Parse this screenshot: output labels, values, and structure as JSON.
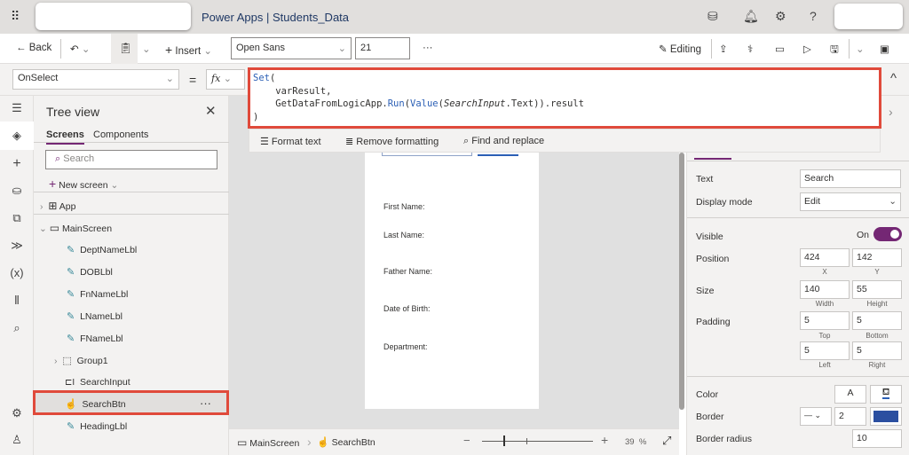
{
  "header": {
    "app": "Power Apps",
    "separator": "|",
    "doc": "Students_Data",
    "icons": [
      "waffle-icon",
      "environment-icon",
      "bell-icon",
      "gear-icon",
      "help-icon"
    ]
  },
  "toolbar": {
    "back": "Back",
    "insert": "Insert",
    "font": "Open Sans",
    "font_size": "21",
    "more": "···",
    "editing": "Editing"
  },
  "formula": {
    "property": "OnSelect",
    "equals": "=",
    "fx": "fx",
    "line1_fn": "Set",
    "line1_rest": "(",
    "line2": "    varResult,",
    "line3_a": "    GetDataFromLogicApp.",
    "line3_run": "Run",
    "line3_b": "(",
    "line3_val": "Value",
    "line3_c": "(",
    "line3_arg": "SearchInput",
    "line3_d": ".Text)).result",
    "line4": ")"
  },
  "format_bar": {
    "format_text": "Format text",
    "remove_formatting": "Remove formatting",
    "find_replace": "Find and replace"
  },
  "tree": {
    "title": "Tree view",
    "tabs": [
      "Screens",
      "Components"
    ],
    "search_placeholder": "Search",
    "new_screen": "New screen",
    "app": "App",
    "screen": "MainScreen",
    "items": [
      "DeptNameLbl",
      "DOBLbl",
      "FnNameLbl",
      "LNameLbl",
      "FNameLbl",
      "Group1",
      "SearchInput",
      "SearchBtn",
      "HeadingLbl"
    ],
    "selected": "SearchBtn",
    "item_more": "···"
  },
  "canvas": {
    "labels": [
      "First Name:",
      "Last Name:",
      "Father Name:",
      "Date of Birth:",
      "Department:"
    ]
  },
  "bottom": {
    "screen": "MainScreen",
    "control": "SearchBtn",
    "zoom": "39",
    "zoom_unit": "%"
  },
  "props": {
    "text_label": "Text",
    "text_value": "Search",
    "display_mode_label": "Display mode",
    "display_mode": "Edit",
    "visible_label": "Visible",
    "visible_state": "On",
    "visible": true,
    "position_label": "Position",
    "x": "424",
    "y": "142",
    "x_lbl": "X",
    "y_lbl": "Y",
    "size_label": "Size",
    "width": "140",
    "height": "55",
    "width_lbl": "Width",
    "height_lbl": "Height",
    "padding_label": "Padding",
    "pad_top": "5",
    "pad_bottom": "5",
    "pad_left": "5",
    "pad_right": "5",
    "top_lbl": "Top",
    "bottom_lbl": "Bottom",
    "left_lbl": "Left",
    "right_lbl": "Right",
    "color_label": "Color",
    "color_glyph": "A",
    "border_label": "Border",
    "border_width": "2",
    "border_color": "#2b4fa0",
    "border_radius_label": "Border radius",
    "border_radius": "10"
  },
  "colors": {
    "accent": "#742774",
    "highlight": "#e04a3b"
  }
}
